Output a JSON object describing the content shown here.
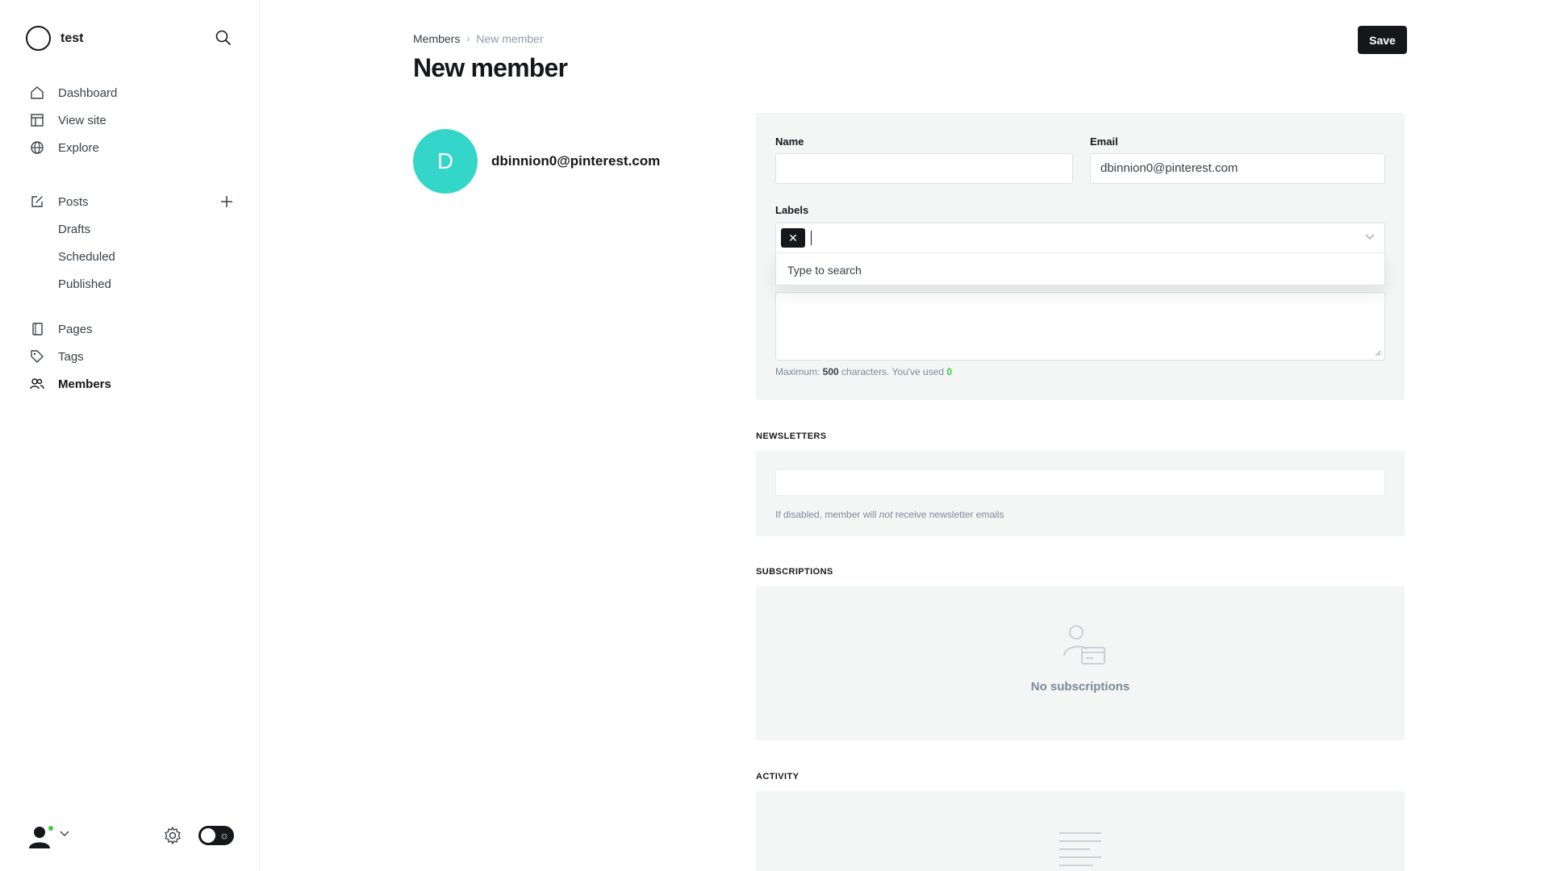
{
  "sidebar": {
    "site_name": "test",
    "nav": [
      {
        "label": "Dashboard",
        "icon": "home-icon"
      },
      {
        "label": "View site",
        "icon": "layout-icon"
      },
      {
        "label": "Explore",
        "icon": "globe-icon"
      }
    ],
    "posts": {
      "label": "Posts",
      "icon": "edit-icon"
    },
    "posts_sub": [
      "Drafts",
      "Scheduled",
      "Published"
    ],
    "nav2": [
      {
        "label": "Pages",
        "icon": "page-icon"
      },
      {
        "label": "Tags",
        "icon": "tag-icon"
      },
      {
        "label": "Members",
        "icon": "members-icon",
        "active": true
      }
    ]
  },
  "header": {
    "breadcrumb_parent": "Members",
    "breadcrumb_current": "New member",
    "title": "New member",
    "save_label": "Save"
  },
  "member": {
    "initial": "D",
    "email": "dbinnion0@pinterest.com",
    "avatar_color": "#33d6c8"
  },
  "form": {
    "name_label": "Name",
    "name_value": "",
    "email_label": "Email",
    "email_value": "dbinnion0@pinterest.com",
    "labels_label": "Labels",
    "token_remove": "✕",
    "dropdown_hint": "Type to search",
    "char_prefix": "Maximum: ",
    "char_max": "500",
    "char_mid": " characters. You've used ",
    "char_used": "0"
  },
  "newsletters": {
    "title": "NEWSLETTERS",
    "help_prefix": "If disabled, member will ",
    "help_em": "not",
    "help_suffix": " receive newsletter emails"
  },
  "subscriptions": {
    "title": "SUBSCRIPTIONS",
    "empty": "No subscriptions"
  },
  "activity": {
    "title": "ACTIVITY"
  },
  "colors": {
    "accent": "#15171a",
    "success": "#30cf43",
    "panel_bg": "#f4f5f5"
  }
}
